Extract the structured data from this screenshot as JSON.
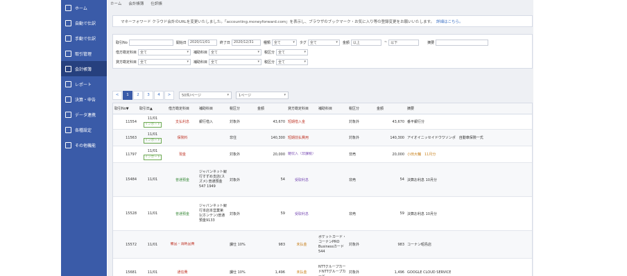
{
  "sidebar": {
    "items": [
      {
        "label": "ホーム",
        "icon": "home-icon"
      },
      {
        "label": "自動で仕訳",
        "icon": "auto-journal-icon"
      },
      {
        "label": "手動で仕訳",
        "icon": "manual-journal-icon"
      },
      {
        "label": "取引管理",
        "icon": "transaction-icon"
      },
      {
        "label": "会計帳簿",
        "icon": "ledger-icon",
        "active": true
      },
      {
        "label": "レポート",
        "icon": "report-icon"
      },
      {
        "label": "決算・申告",
        "icon": "settlement-icon"
      },
      {
        "label": "データ連携",
        "icon": "data-link-icon"
      },
      {
        "label": "各種設定",
        "icon": "gear-icon"
      },
      {
        "label": "その他機能",
        "icon": "list-icon"
      }
    ]
  },
  "breadcrumb": [
    "ホーム",
    "会計帳簿",
    "仕訳帳"
  ],
  "notice": {
    "text": "マネーフォワード クラウド会計のURLを変更いたしました。「accounting.moneyforward.com」を表示し、ブラウザのブックマーク・お気に入り等の登録変更をお願いいたします。",
    "link": "詳細はこちら。"
  },
  "filters": {
    "row1": {
      "id_label": "取引No",
      "start_label": "開始日",
      "start_value": "2020/11/01",
      "end_label": "終了日",
      "end_value": "2020/12/31",
      "memo_label": "種類",
      "memo_value": "全て",
      "tag_label": "タグ",
      "tag_value": "全て",
      "amount_label": "金額",
      "amount_min": "以上",
      "tilde": "~",
      "amount_max": "以下",
      "remarks_label": "摘要"
    },
    "row2": {
      "account_label": "借方勘定科目",
      "account_value": "全て",
      "sub_label": "補助科目",
      "sub_value": "全て",
      "tax_label": "税区分",
      "tax_value": "全て"
    },
    "row3": {
      "account_label": "貸方勘定科目",
      "account_value": "全て",
      "sub_label": "補助科目",
      "sub_value": "全て",
      "tax_label": "税区分",
      "tax_value": "全て"
    }
  },
  "pager": {
    "prev": "<",
    "pages": [
      "1",
      "2",
      "3",
      "4"
    ],
    "next": ">",
    "per_page": "50件/ページ",
    "page_select": "1ページ"
  },
  "table": {
    "headers": [
      "取引No▼",
      "取引日▲",
      "借方勘定科目",
      "補助科目",
      "税区分",
      "金額",
      "貸方勘定科目",
      "補助科目",
      "税区分",
      "金額",
      "摘要"
    ],
    "rows": [
      {
        "no": "11554",
        "date": "11/01",
        "badge": "インポート",
        "dr_account": "支払利息",
        "dr_sub": "銀行借入",
        "dr_tax": "対象外",
        "dr_amount": "43,670",
        "cr_account": "短期借入金",
        "cr_sub": "",
        "cr_tax": "対象外",
        "cr_amount": "43,670",
        "memo": "番平銀行分"
      },
      {
        "no": "11563",
        "date": "11/01",
        "badge": "インポート",
        "dr_account": "保険料",
        "dr_sub": "",
        "dr_tax": "非住",
        "dr_amount": "140,300",
        "cr_account": "短期前払費用",
        "cr_sub": "",
        "cr_tax": "対象外",
        "cr_amount": "140,300",
        "memo": "アイオイニッセイドウワソンポ　自動車保険一式"
      },
      {
        "no": "11797",
        "date": "11/01",
        "badge": "インポート",
        "dr_account": "現金",
        "dr_sub": "",
        "dr_tax": "対象外",
        "dr_amount": "20,000",
        "cr_account": "雑収入（非課税）",
        "cr_sub": "",
        "cr_tax": "非売",
        "cr_amount": "20,000",
        "memo": "小田大輔　11月分"
      },
      {
        "no": "15484",
        "date": "11/01",
        "badge": "",
        "dr_account": "普通預金",
        "dr_sub": "ジャパンネット銀行すずめ支店(スズメ) 普通預金547 1949",
        "dr_tax": "対象外",
        "dr_amount": "54",
        "cr_account": "受取利息",
        "cr_sub": "",
        "cr_tax": "非売",
        "cr_amount": "54",
        "memo": "決算お利息 10月分"
      },
      {
        "no": "15528",
        "date": "11/01",
        "badge": "",
        "dr_account": "普通預金",
        "dr_sub": "ジャパンネット銀行本店本営業第1(ホンテン)普通預金9133",
        "dr_tax": "対象外",
        "dr_amount": "59",
        "cr_account": "受取利息",
        "cr_sub": "",
        "cr_tax": "非売",
        "cr_amount": "59",
        "memo": "決算お利息 10月分"
      },
      {
        "no": "15572",
        "date": "11/01",
        "badge": "",
        "dr_account": "備品・消耗品費",
        "dr_sub": "",
        "dr_tax": "課仕 10%",
        "dr_amount": "983",
        "cr_account": "未払金",
        "cr_sub": "ポケットカード・コーナンPRO Businessカード544",
        "cr_tax": "対象外",
        "cr_amount": "983",
        "memo": "コーナン昭島店"
      },
      {
        "no": "15681",
        "date": "11/01",
        "badge": "",
        "dr_account": "通信費",
        "dr_sub": "",
        "dr_tax": "課仕 10%",
        "dr_amount": "1,496",
        "cr_account": "未払金",
        "cr_sub": "NTTグループカードNTTグループカード",
        "cr_tax": "対象外",
        "cr_amount": "1,496",
        "memo": "GOOGLE CLOUD SERVICE"
      }
    ]
  }
}
